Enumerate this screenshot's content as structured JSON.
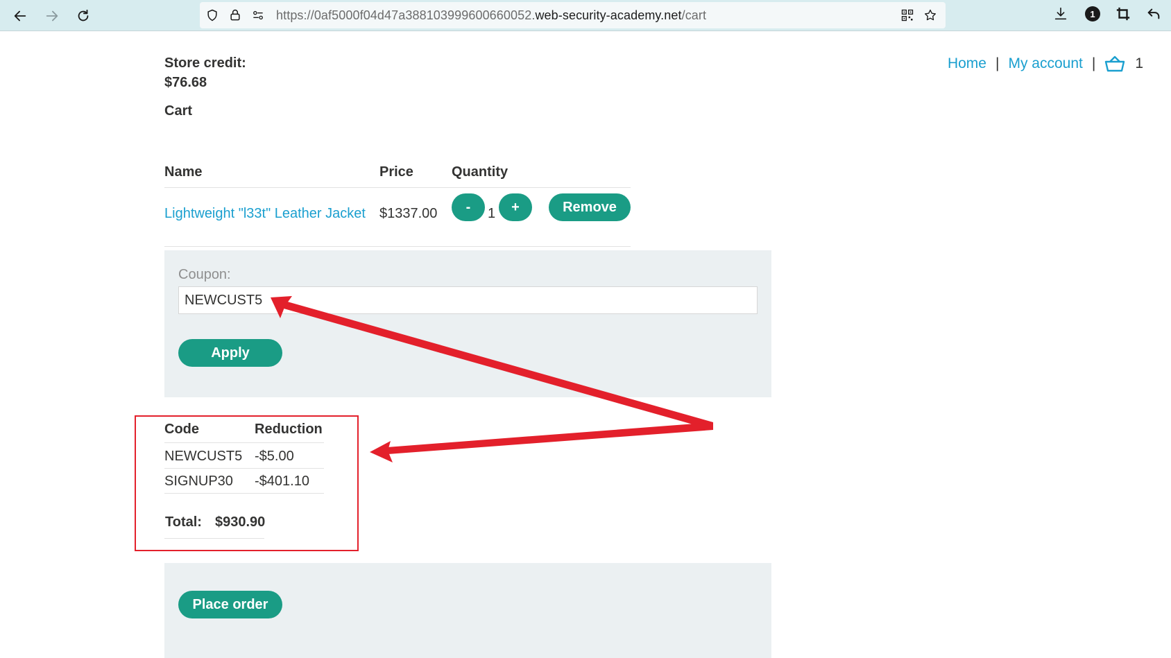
{
  "browser": {
    "url_prefix": "https://0af5000f04d47a388103999600660052.",
    "url_domain": "web-security-academy.net",
    "url_path": "/cart",
    "icons": [
      "back-arrow-icon",
      "forward-arrow-icon",
      "reload-icon",
      "shield-icon",
      "lock-icon",
      "site-settings-icon",
      "qr-code-icon",
      "bookmark-star-icon",
      "download-icon",
      "extension-badge-icon",
      "crop-icon",
      "undo-icon"
    ],
    "extension_badge": "1"
  },
  "header": {
    "home_link": "Home",
    "separator": "|",
    "account_link": "My account",
    "cart_count": "1"
  },
  "account": {
    "store_credit_label": "Store credit:",
    "store_credit_value": "$76.68"
  },
  "cart": {
    "heading": "Cart",
    "columns": [
      "Name",
      "Price",
      "Quantity"
    ],
    "items": [
      {
        "name": "Lightweight \"l33t\" Leather Jacket",
        "price": "$1337.00",
        "quantity": "1"
      }
    ],
    "decrement_label": "-",
    "increment_label": "+",
    "remove_label": "Remove"
  },
  "coupon": {
    "label": "Coupon:",
    "value": "NEWCUST5",
    "apply_label": "Apply"
  },
  "reductions": {
    "columns": [
      "Code",
      "Reduction"
    ],
    "rows": [
      {
        "code": "NEWCUST5",
        "amount": "-$5.00"
      },
      {
        "code": "SIGNUP30",
        "amount": "-$401.10"
      }
    ],
    "total_label": "Total:",
    "total_value": "$930.90"
  },
  "order": {
    "place_order_label": "Place order"
  },
  "colors": {
    "accent_button": "#1a9c85",
    "link": "#1a9fcf",
    "annotation_red": "#e3202b",
    "panel_bg": "#ebf0f2"
  }
}
